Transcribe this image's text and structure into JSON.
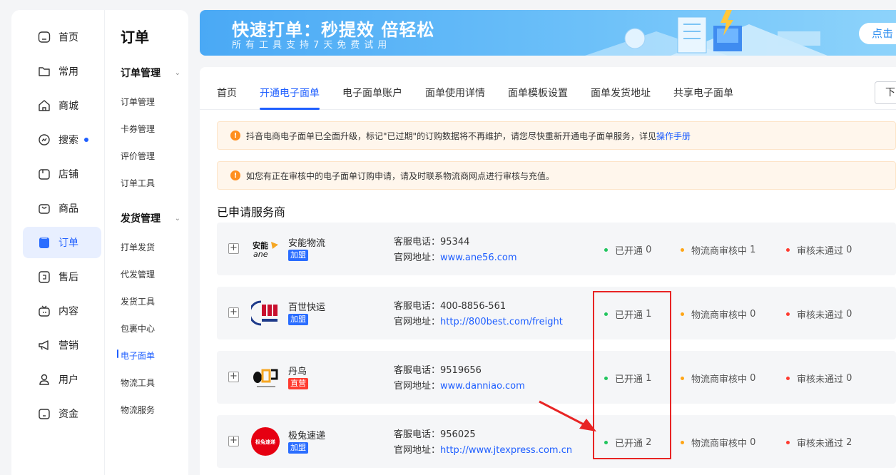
{
  "nav": {
    "items": [
      {
        "label": "首页",
        "icon": "home-icon"
      },
      {
        "label": "常用",
        "icon": "folder-icon"
      },
      {
        "label": "商城",
        "icon": "house-icon"
      },
      {
        "label": "搜索",
        "icon": "search-icon"
      },
      {
        "label": "店铺",
        "icon": "store-icon"
      },
      {
        "label": "商品",
        "icon": "bag-icon"
      },
      {
        "label": "订单",
        "icon": "order-icon"
      },
      {
        "label": "售后",
        "icon": "refund-icon"
      },
      {
        "label": "内容",
        "icon": "tv-icon"
      },
      {
        "label": "营销",
        "icon": "megaphone-icon"
      },
      {
        "label": "用户",
        "icon": "user-icon"
      },
      {
        "label": "资金",
        "icon": "wallet-icon"
      }
    ],
    "active": "订单"
  },
  "submenu": {
    "title": "订单",
    "groups": [
      {
        "label": "订单管理",
        "items": [
          "订单管理",
          "卡券管理",
          "评价管理",
          "订单工具"
        ]
      },
      {
        "label": "发货管理",
        "items": [
          "打单发货",
          "代发管理",
          "发货工具",
          "包裹中心",
          "电子面单",
          "物流工具",
          "物流服务"
        ]
      }
    ],
    "active_item": "电子面单"
  },
  "banner": {
    "title": "快速打单：秒提效 倍轻松",
    "subtitle": "所有工具支持7天免费试用",
    "button": "点击"
  },
  "tabs": [
    "首页",
    "开通电子面单",
    "电子面单账户",
    "面单使用详情",
    "面单模板设置",
    "面单发货地址",
    "共享电子面单"
  ],
  "active_tab": "开通电子面单",
  "tab_button": "下",
  "notices": [
    {
      "text": "抖音电商电子面单已全面升级，标记\"已过期\"的订购数据将不再维护，请您尽快重新开通电子面单服务，详见",
      "link": "操作手册"
    },
    {
      "text": "如您有正在审核中的电子面单订购申请，请及时联系物流商网点进行审核与充值。",
      "link": ""
    }
  ],
  "section_title": "已申请服务商",
  "labels": {
    "phone": "客服电话：",
    "site": "官网地址：",
    "opened": "已开通",
    "reviewing": "物流商审核中",
    "rejected": "审核未通过"
  },
  "providers": [
    {
      "name": "安能物流",
      "badge": "加盟",
      "badge_color": "#2a6dff",
      "phone": "95344",
      "url": "www.ane56.com",
      "opened": "0",
      "reviewing": "1",
      "rejected": "0",
      "logo": "ane-logo"
    },
    {
      "name": "百世快运",
      "badge": "加盟",
      "badge_color": "#2a6dff",
      "phone": "400-8856-561",
      "url": "http://800best.com/freight",
      "opened": "1",
      "reviewing": "0",
      "rejected": "0",
      "logo": "best-logo"
    },
    {
      "name": "丹鸟",
      "badge": "直营",
      "badge_color": "#ff3b30",
      "phone": "9519656",
      "url": "www.danniao.com",
      "opened": "1",
      "reviewing": "0",
      "rejected": "0",
      "logo": "danniao-logo"
    },
    {
      "name": "极兔速递",
      "badge": "加盟",
      "badge_color": "#2a6dff",
      "phone": "956025",
      "url": "http://www.jtexpress.com.cn",
      "opened": "2",
      "reviewing": "0",
      "rejected": "2",
      "logo": "jtexpress-logo"
    }
  ],
  "logo_text": {
    "ane": "安能",
    "ane_sub": "ane",
    "jt": "极兔速递"
  }
}
